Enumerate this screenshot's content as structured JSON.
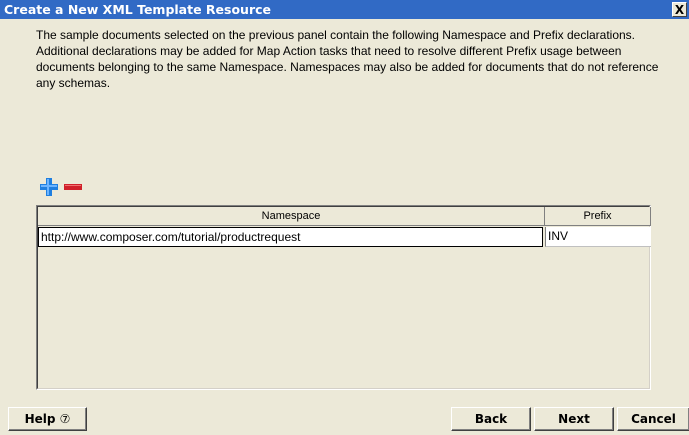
{
  "window": {
    "title": "Create a New XML Template Resource",
    "close_label": "X"
  },
  "description": "The sample documents selected on the previous panel contain the following Namespace and Prefix declarations. Additional declarations may be added for Map Action tasks that need to resolve different Prefix usage between documents belonging to the same Namespace. Namespaces may also be added for documents that do not reference any schemas.",
  "toolbar": {
    "add_icon": "plus-icon",
    "remove_icon": "minus-icon",
    "colors": {
      "add": "#1f7fe0",
      "remove": "#d0202a"
    }
  },
  "table": {
    "columns": [
      "Namespace",
      "Prefix"
    ],
    "rows": [
      {
        "namespace": "http://www.composer.com/tutorial/productrequest",
        "prefix": "INV"
      }
    ]
  },
  "footer": {
    "help_label": "Help",
    "help_icon_glyph": "⑦",
    "back_label": "Back",
    "next_label": "Next",
    "cancel_label": "Cancel"
  }
}
